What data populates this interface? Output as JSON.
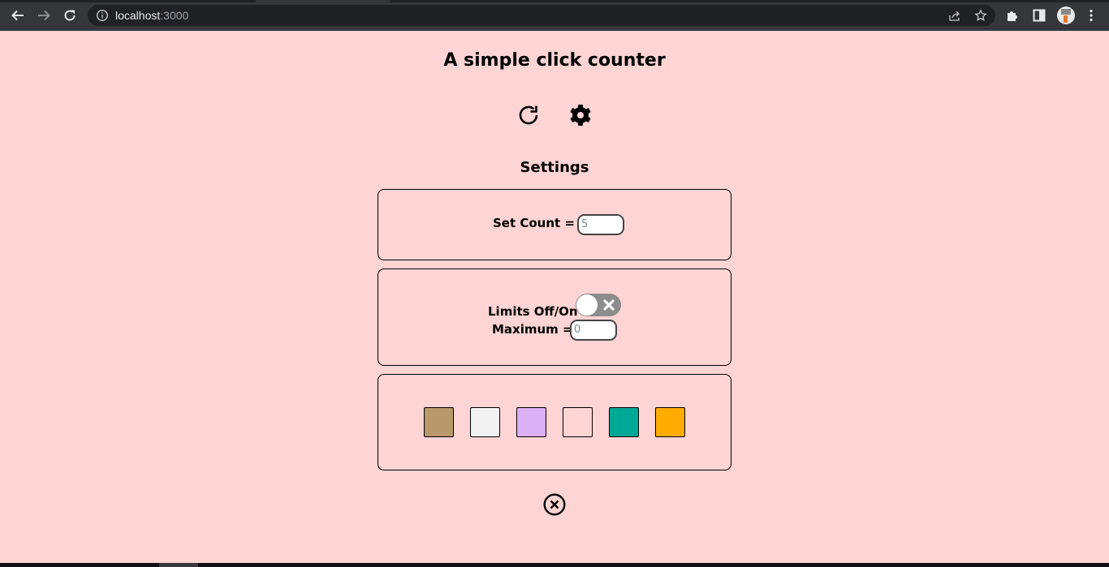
{
  "browser": {
    "url_host": "localhost",
    "url_port": ":3000",
    "icons": {
      "back": "back-arrow-icon",
      "forward": "forward-arrow-icon",
      "reload": "reload-icon",
      "info": "info-icon",
      "share": "share-icon",
      "bookmark": "star-icon",
      "extensions": "puzzle-icon",
      "sidepanel": "side-panel-icon",
      "profile": "avatar",
      "menu": "kebab-menu-icon"
    }
  },
  "app": {
    "title": "A simple click counter",
    "controls": {
      "reset_icon": "reset-icon",
      "settings_icon": "gear-icon"
    },
    "settings": {
      "heading": "Settings",
      "set_count": {
        "label": "Set Count =",
        "placeholder": "5"
      },
      "limits": {
        "toggle_label": "Limits Off/On",
        "toggle_state": "off",
        "max_label": "Maximum =",
        "max_placeholder": "0"
      },
      "themes": [
        {
          "name": "tan",
          "color": "#b9996b"
        },
        {
          "name": "light-gray",
          "color": "#f2f2f2"
        },
        {
          "name": "lavender",
          "color": "#dbb0f5"
        },
        {
          "name": "pink",
          "color": "#ffd4d4"
        },
        {
          "name": "teal",
          "color": "#00a896"
        },
        {
          "name": "orange",
          "color": "#ffab00"
        }
      ],
      "close_icon": "close-circle-icon"
    },
    "colors": {
      "background": "#ffd4d4",
      "toggle_off": "#8c8c8c"
    }
  }
}
